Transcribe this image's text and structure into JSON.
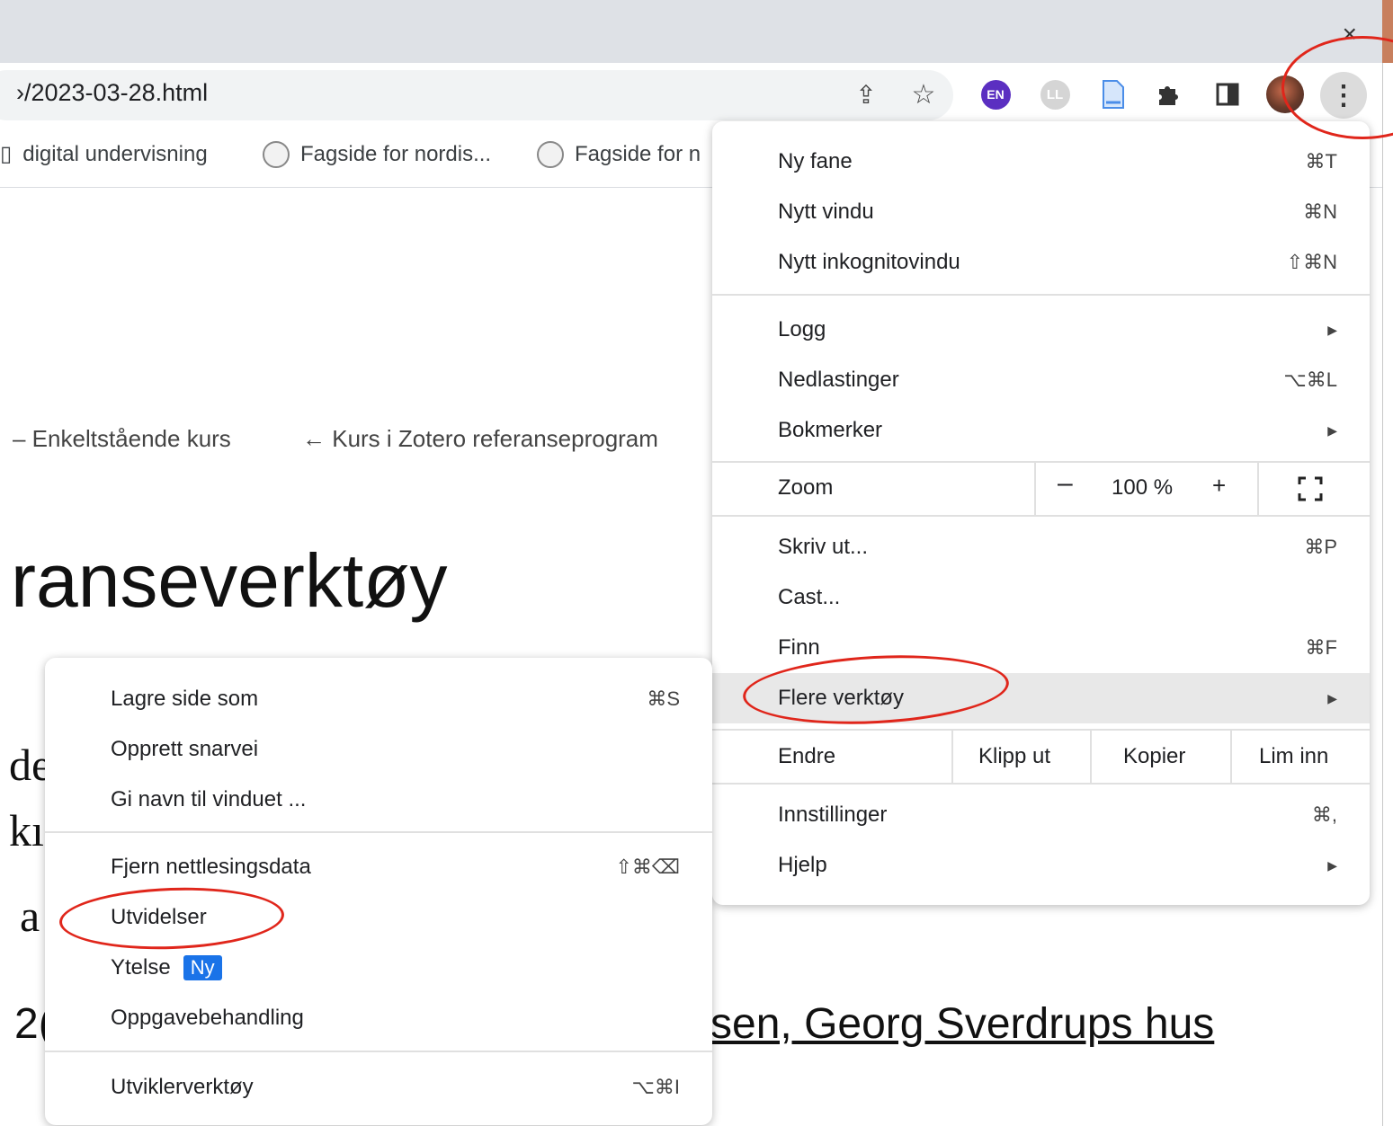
{
  "browser": {
    "close_glyph": "×",
    "url": "›/2023-03-28.html",
    "extensions": {
      "en_label": "EN",
      "ll_label": "LL"
    },
    "icons": [
      "share-icon",
      "star-icon",
      "puzzle-icon",
      "side-panel-icon",
      "kebab-menu-icon"
    ]
  },
  "bookmarks": [
    {
      "label": "digital undervisning",
      "prefix": "▯"
    },
    {
      "label": "Fagside for nordis..."
    },
    {
      "label": "Fagside for n"
    }
  ],
  "page": {
    "breadcrumb_1": "– Enkeltstående kurs",
    "breadcrumb_2": "← Kurs i Zotero referanseprogram",
    "heading": "ranseverktøy",
    "fragment_d": "de",
    "fragment_k": "kı",
    "fragment_a": "a",
    "fragment_2": "2(",
    "location_link": "sen, Georg Sverdrups hus"
  },
  "main_menu": {
    "items": [
      {
        "label": "Ny fane",
        "shortcut": "⌘T"
      },
      {
        "label": "Nytt vindu",
        "shortcut": "⌘N"
      },
      {
        "label": "Nytt inkognitovindu",
        "shortcut": "⇧⌘N"
      },
      {
        "label": "Logg",
        "submenu": "▶"
      },
      {
        "label": "Nedlastinger",
        "shortcut": "⌥⌘L"
      },
      {
        "label": "Bokmerker",
        "submenu": "▶"
      },
      {
        "label": "Skriv ut...",
        "shortcut": "⌘P"
      },
      {
        "label": "Cast..."
      },
      {
        "label": "Finn",
        "shortcut": "⌘F"
      },
      {
        "label": "Flere verktøy",
        "submenu": "▶"
      },
      {
        "label": "Innstillinger",
        "shortcut": "⌘,"
      },
      {
        "label": "Hjelp",
        "submenu": "▶"
      }
    ],
    "zoom": {
      "label": "Zoom",
      "minus": "–",
      "value": "100 %",
      "plus": "+"
    },
    "edit": {
      "label": "Endre",
      "cut": "Klipp ut",
      "copy": "Kopier",
      "paste": "Lim inn"
    }
  },
  "sub_menu": {
    "items": [
      {
        "label": "Lagre side som",
        "shortcut": "⌘S"
      },
      {
        "label": "Opprett snarvei"
      },
      {
        "label": "Gi navn til vinduet ..."
      },
      {
        "label": "Fjern nettlesingsdata",
        "shortcut": "⇧⌘⌫"
      },
      {
        "label": "Utvidelser"
      },
      {
        "label": "Ytelse",
        "badge": "Ny"
      },
      {
        "label": "Oppgavebehandling"
      },
      {
        "label": "Utviklerverktøy",
        "shortcut": "⌥⌘I"
      }
    ]
  },
  "colors": {
    "annotation": "#e0261b",
    "accent": "#1a73e8",
    "highlight": "#e8e8e8"
  }
}
